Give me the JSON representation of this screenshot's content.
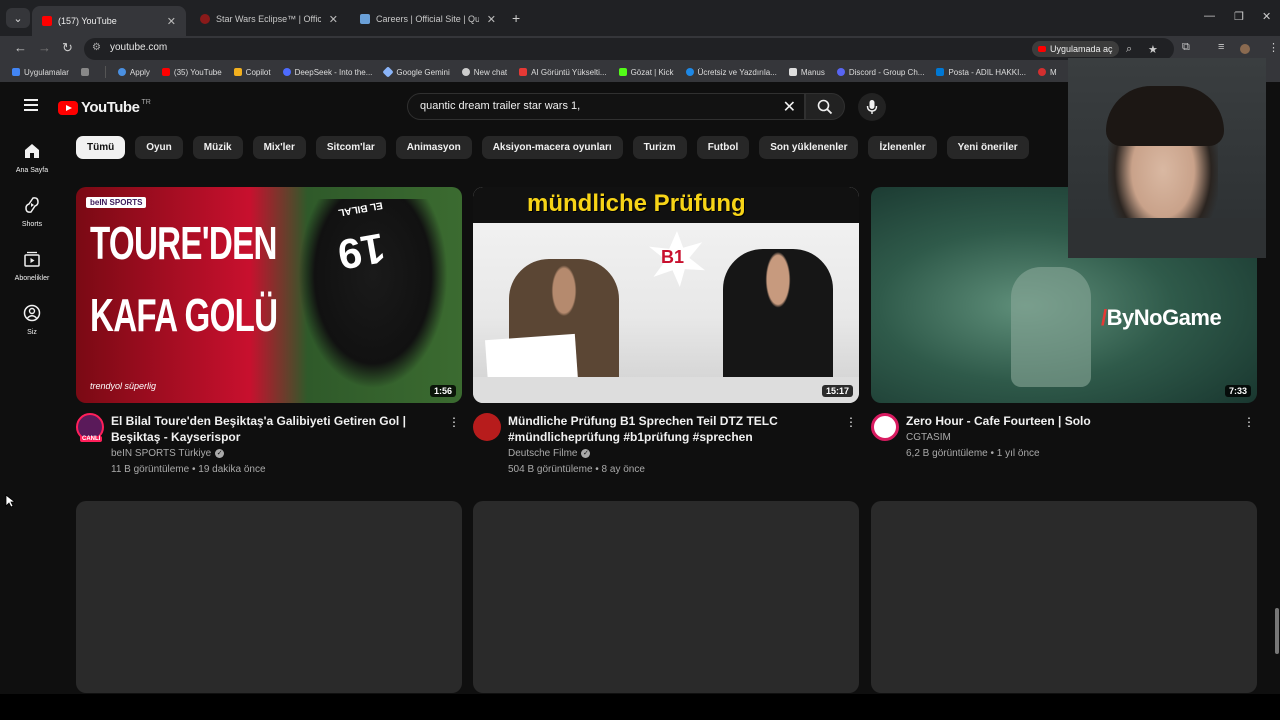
{
  "browser": {
    "tabs": [
      {
        "title": "(157) YouTube",
        "active": true,
        "fav": "#ff0000"
      },
      {
        "title": "Star Wars Eclipse™ | Official Site",
        "active": false,
        "fav": "#8a1a1a"
      },
      {
        "title": "Careers | Official Site | Quantic Dream",
        "active": false,
        "fav": "#6aa0d8"
      }
    ],
    "url": "youtube.com",
    "open_in_app": "Uygulamada aç",
    "bookmarks": [
      {
        "label": "Uygulamalar",
        "color": "#4285f4"
      },
      {
        "label": "Apply",
        "color": "#4a90e2"
      },
      {
        "label": "(35) YouTube",
        "color": "#ff0000"
      },
      {
        "label": "Copilot",
        "color": "#f2b01e"
      },
      {
        "label": "DeepSeek - Into the...",
        "color": "#4d6bfe"
      },
      {
        "label": "Google Gemini",
        "color": "#8ab4f8"
      },
      {
        "label": "New chat",
        "color": "#cccccc"
      },
      {
        "label": "AI Görüntü Yükselti...",
        "color": "#e53935"
      },
      {
        "label": "Gözat | Kick",
        "color": "#53fc18"
      },
      {
        "label": "Ücretsiz ve Yazdırıla...",
        "color": "#1e88e5"
      },
      {
        "label": "Manus",
        "color": "#dddddd"
      },
      {
        "label": "Discord - Group Ch...",
        "color": "#5865f2"
      },
      {
        "label": "Posta - ADIL HAKKI...",
        "color": "#0078d4"
      },
      {
        "label": "M",
        "color": "#d32f2f"
      }
    ]
  },
  "youtube": {
    "logo_text": "YouTube",
    "country": "TR",
    "search_query": "quantic dream trailer star wars 1,",
    "sidebar": [
      {
        "label": "Ana Sayfa",
        "icon": "home-icon"
      },
      {
        "label": "Shorts",
        "icon": "shorts-icon"
      },
      {
        "label": "Abonelikler",
        "icon": "subscriptions-icon"
      },
      {
        "label": "Siz",
        "icon": "you-icon"
      }
    ],
    "chips": [
      "Tümü",
      "Oyun",
      "Müzik",
      "Mix'ler",
      "Sitcom'lar",
      "Animasyon",
      "Aksiyon-macera oyunları",
      "Turizm",
      "Futbol",
      "Son yüklenenler",
      "İzlenenler",
      "Yeni öneriler"
    ],
    "videos": [
      {
        "title": "El Bilal Toure'den Beşiktaş'a Galibiyeti Getiren Gol | Beşiktaş - Kayserispor",
        "channel": "beIN SPORTS Türkiye",
        "verified": true,
        "stats": "11 B görüntüleme • 19 dakika önce",
        "duration": "1:56",
        "thumb_text": [
          "TOURE'DEN",
          "KAFA GOLÜ"
        ],
        "thumb_brand": "beIN SPORTS",
        "thumb_sub": "trendyol süperlig",
        "jersey": "19",
        "jersey_name": "EL BILAL",
        "avatar_badge": "CANLI",
        "avatar_color": "#5a1a5a"
      },
      {
        "title": "Mündliche Prüfung B1 Sprechen Teil DTZ TELC #mündlicheprüfung #b1prüfung #sprechen",
        "channel": "Deutsche Filme",
        "verified": true,
        "stats": "504 B görüntüleme • 8 ay önce",
        "duration": "15:17",
        "thumb_text": [
          "mündliche Prüfung"
        ],
        "thumb_badge": "B1",
        "avatar_color": "#b71c1c"
      },
      {
        "title": "Zero Hour - Cafe Fourteen | Solo",
        "channel": "CGTASIM",
        "verified": false,
        "stats": "6,2 B görüntüleme • 1 yıl önce",
        "duration": "7:33",
        "thumb_text": [
          "ByNoGame"
        ],
        "avatar_color": "#d81b60"
      }
    ]
  }
}
